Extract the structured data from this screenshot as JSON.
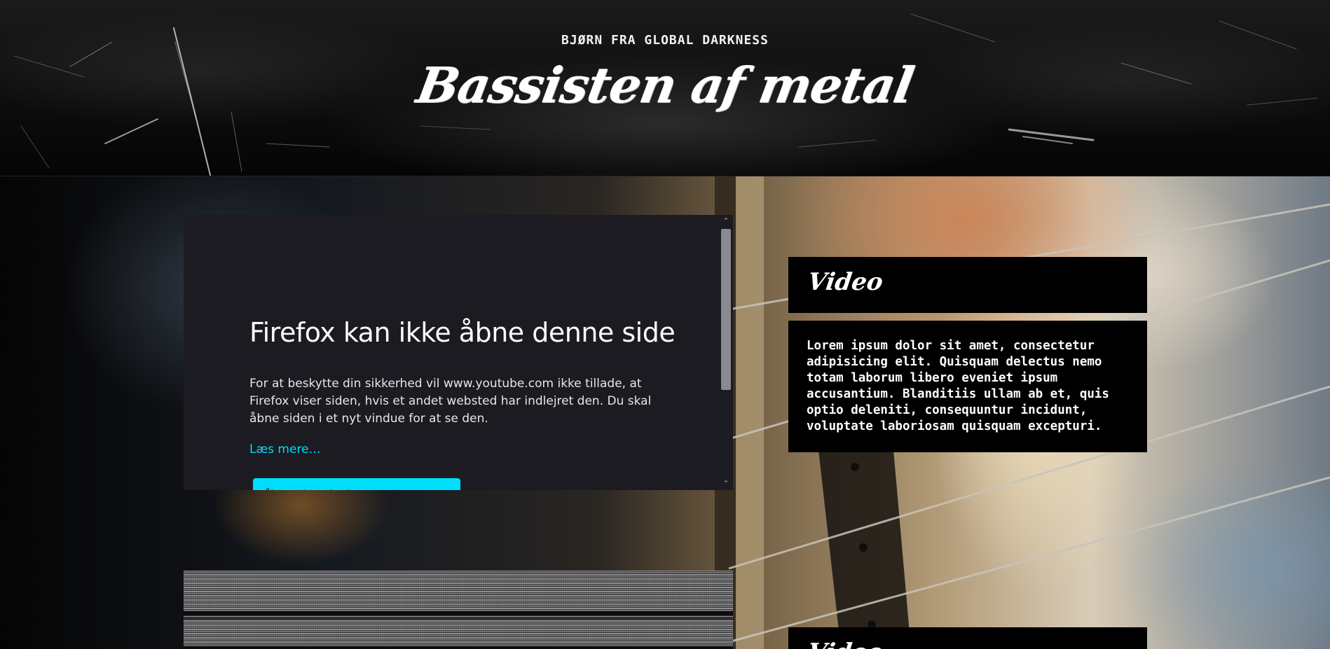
{
  "header": {
    "kicker": "BJØRN FRA GLOBAL DARKNESS",
    "title": "Bassisten af metal"
  },
  "embed": {
    "error_title": "Firefox kan ikke åbne denne side",
    "error_body": "For at beskytte din sikkerhed vil www.youtube.com ikke tillade, at Firefox viser siden, hvis et andet websted har indlejret den. Du skal åbne siden i et nyt vindue for at se den.",
    "learn_more": "Læs mere…",
    "open_button": "Åbn webstedet i et nyt vindue",
    "scroll_up": "⌃",
    "scroll_down": "⌄"
  },
  "sections": [
    {
      "heading": "Video",
      "text": "Lorem ipsum dolor sit amet, consectetur adipisicing elit. Quisquam delectus nemo totam laborum libero eveniet ipsum accusantium. Blanditiis ullam ab et, quis optio deleniti, consequuntur incidunt, voluptate laboriosam quisquam excepturi."
    },
    {
      "heading": "Video"
    }
  ],
  "colors": {
    "accent": "#00ddff",
    "embed_bg": "#1c1b22",
    "card_bg": "#000000",
    "text": "#ffffff"
  }
}
